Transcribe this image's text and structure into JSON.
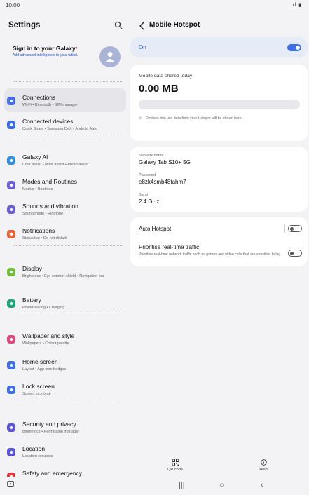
{
  "status": {
    "time": "10:00",
    "icons": ".ıl ▮"
  },
  "left": {
    "title": "Settings",
    "account": {
      "title": "Sign in to your Galaxy",
      "dot": "•",
      "subtitle": "Add advanced intelligence to your tablet."
    },
    "items": [
      {
        "title": "Connections",
        "sub": "Wi-Fi  •  Bluetooth  •  SIM manager",
        "color": "#3c6ee8",
        "icon": "wifi-icon"
      },
      {
        "title": "Connected devices",
        "sub": "Quick Share  •  Samsung DeX  •  Android Auto",
        "color": "#3c6ee8",
        "icon": "devices-icon"
      },
      {
        "title": "Galaxy AI",
        "sub": "Chat assist  •  Note assist  •  Photo assist",
        "color": "#2f8fe0",
        "icon": "ai-sparkle-icon"
      },
      {
        "title": "Modes and Routines",
        "sub": "Modes  •  Routines",
        "color": "#6b5fd3",
        "icon": "modes-icon"
      },
      {
        "title": "Sounds and vibration",
        "sub": "Sound mode  •  Ringtone",
        "color": "#6b5fd3",
        "icon": "sound-icon"
      },
      {
        "title": "Notifications",
        "sub": "Status bar  •  Do not disturb",
        "color": "#e8643b",
        "icon": "notification-icon"
      },
      {
        "title": "Display",
        "sub": "Brightness  •  Eye comfort shield  •  Navigation bar",
        "color": "#6fbf3a",
        "icon": "display-icon"
      },
      {
        "title": "Battery",
        "sub": "Power saving  •  Charging",
        "color": "#1aa57a",
        "icon": "battery-icon"
      },
      {
        "title": "Wallpaper and style",
        "sub": "Wallpapers  •  Colour palette",
        "color": "#e04a7a",
        "icon": "wallpaper-icon"
      },
      {
        "title": "Home screen",
        "sub": "Layout  •  App icon badges",
        "color": "#3c6ee8",
        "icon": "home-icon"
      },
      {
        "title": "Lock screen",
        "sub": "Screen lock type",
        "color": "#3c6ee8",
        "icon": "lock-icon"
      },
      {
        "title": "Security and privacy",
        "sub": "Biometrics  •  Permission manager",
        "color": "#5a55d6",
        "icon": "shield-icon"
      },
      {
        "title": "Location",
        "sub": "Location requests",
        "color": "#5a55d6",
        "icon": "location-icon"
      },
      {
        "title": "Safety and emergency",
        "sub": "",
        "color": "#e23b3b",
        "icon": "emergency-icon"
      }
    ]
  },
  "right": {
    "title": "Mobile Hotspot",
    "on_label": "On",
    "data": {
      "label": "Mobile data shared today",
      "value": "0.00 MB",
      "progress": 0,
      "note": "Devices that use data from your Hotspot will be shown here."
    },
    "network": {
      "name_label": "Network name",
      "name": "Galaxy Tab S10+ 5G",
      "password_label": "Password",
      "password": "e8zk4smb48tahm7",
      "band_label": "Band",
      "band": "2.4 GHz"
    },
    "auto_hotspot": "Auto Hotspot",
    "realtime": {
      "title": "Prioritise real-time traffic",
      "sub": "Prioritise real-time network traffic such as games and video calls that are sensitive to lag."
    },
    "actions": {
      "qr": "QR code",
      "help": "Help"
    }
  },
  "colors": {
    "accent": "#3c6ee8",
    "selected": "#e6e6ea"
  }
}
